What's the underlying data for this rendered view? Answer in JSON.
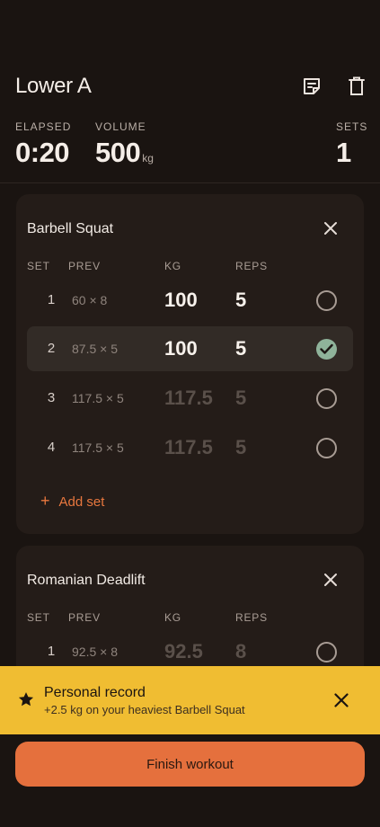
{
  "workout": {
    "title": "Lower A",
    "stats": {
      "elapsed_label": "ELAPSED",
      "elapsed_value": "0:20",
      "volume_label": "VOLUME",
      "volume_value": "500",
      "volume_unit": "kg",
      "sets_label": "SETS",
      "sets_value": "1"
    }
  },
  "column_headers": {
    "set": "SET",
    "prev": "PREV",
    "kg": "KG",
    "reps": "REPS"
  },
  "exercises": [
    {
      "name": "Barbell Squat",
      "sets": [
        {
          "set": "1",
          "prev": "60 × 8",
          "kg": "100",
          "reps": "5",
          "completed": false,
          "placeholder": false
        },
        {
          "set": "2",
          "prev": "87.5 × 5",
          "kg": "100",
          "reps": "5",
          "completed": true,
          "placeholder": false
        },
        {
          "set": "3",
          "prev": "117.5 × 5",
          "kg": "117.5",
          "reps": "5",
          "completed": false,
          "placeholder": true
        },
        {
          "set": "4",
          "prev": "117.5 × 5",
          "kg": "117.5",
          "reps": "5",
          "completed": false,
          "placeholder": true
        }
      ],
      "add_set_label": "Add set"
    },
    {
      "name": "Romanian Deadlift",
      "sets": [
        {
          "set": "1",
          "prev": "92.5 × 8",
          "kg": "92.5",
          "reps": "8",
          "completed": false,
          "placeholder": true
        }
      ]
    }
  ],
  "toast": {
    "icon": "star-icon",
    "title": "Personal record",
    "message": "+2.5 kg on your heaviest Barbell Squat"
  },
  "finish_label": "Finish workout",
  "colors": {
    "background": "#1a1411",
    "card": "#241c18",
    "accent": "#e5703d",
    "check_done": "#8fb39a",
    "toast": "#f0bd32"
  }
}
